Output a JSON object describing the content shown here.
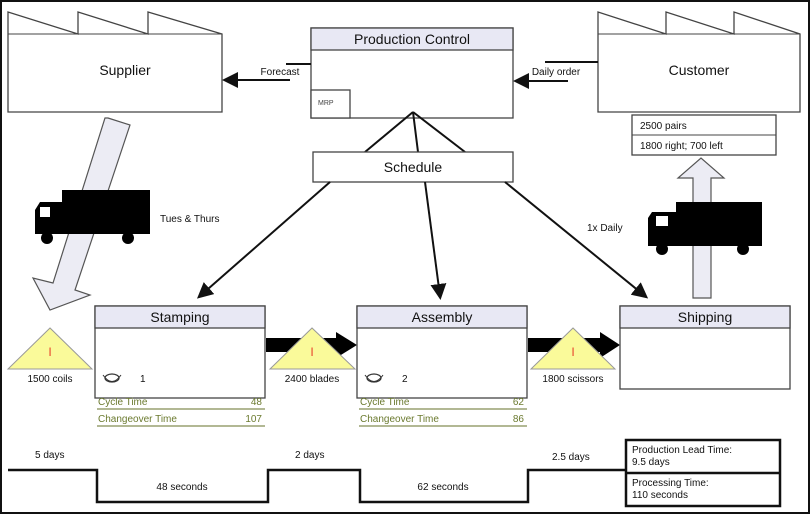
{
  "supplier": {
    "label": "Supplier"
  },
  "customer": {
    "label": "Customer",
    "requirements": [
      "2500 pairs",
      "1800 right; 700 left"
    ]
  },
  "production_control": {
    "label": "Production Control",
    "system": "MRP"
  },
  "schedule": {
    "label": "Schedule"
  },
  "flows": {
    "forecast": "Forecast",
    "daily_order": "Daily order",
    "inbound_shipment": "Tues & Thurs",
    "outbound_shipment": "1x Daily"
  },
  "processes": [
    {
      "name": "Stamping",
      "operators": "1",
      "metrics": [
        {
          "label": "Cycle Time",
          "value": "48"
        },
        {
          "label": "Changeover Time",
          "value": "107"
        }
      ]
    },
    {
      "name": "Assembly",
      "operators": "2",
      "metrics": [
        {
          "label": "Cycle Time",
          "value": "62"
        },
        {
          "label": "Changeover Time",
          "value": "86"
        }
      ]
    },
    {
      "name": "Shipping"
    }
  ],
  "inventory": [
    {
      "symbol": "I",
      "label": "1500 coils"
    },
    {
      "symbol": "I",
      "label": "2400 blades"
    },
    {
      "symbol": "I",
      "label": "1800 scissors"
    }
  ],
  "timeline": {
    "waits": [
      "5 days",
      "2 days",
      "2.5 days"
    ],
    "process_times": [
      "48 seconds",
      "62 seconds"
    ],
    "lead_time_label": "Production Lead Time:",
    "lead_time_value": "9.5 days",
    "processing_label": "Processing Time:",
    "processing_value": "110 seconds"
  },
  "colors": {
    "inventory_fill": "#fafa9a",
    "inventory_symbol": "#e8402a",
    "metric_text": "#6b7a2f",
    "header_fill": "#e8e8f4"
  }
}
